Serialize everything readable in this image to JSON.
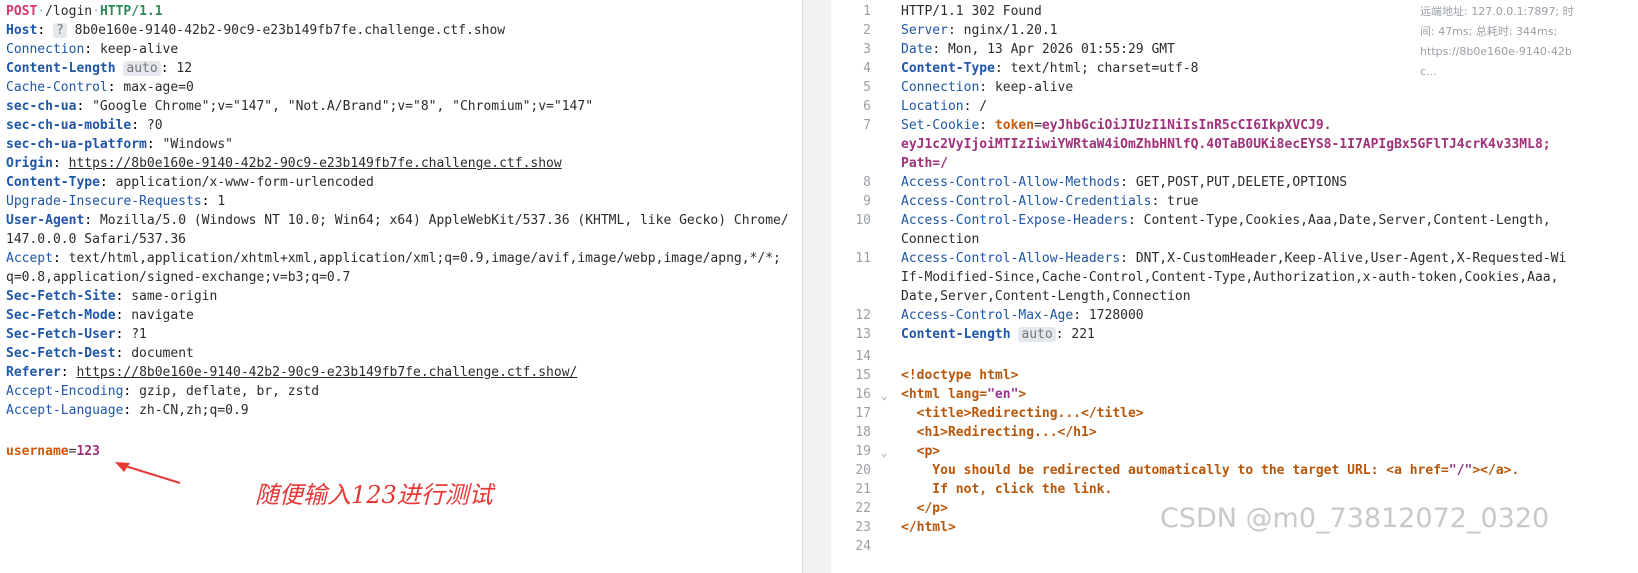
{
  "request": {
    "method": "POST",
    "path": "/login",
    "version": "HTTP/1.1",
    "headers": [
      {
        "k": "Host",
        "v": "8b0e160e-9140-42b2-90c9-e23b149fb7fe.challenge.ctf.show",
        "bold": true
      },
      {
        "k": "Connection",
        "v": "keep-alive",
        "bold": false
      },
      {
        "k": "Content-Length",
        "v": "12",
        "bold": true
      },
      {
        "k": "Cache-Control",
        "v": "max-age=0",
        "bold": false
      },
      {
        "k": "sec-ch-ua",
        "v": "\"Google Chrome\";v=\"147\", \"Not.A/Brand\";v=\"8\", \"Chromium\";v=\"147\"",
        "bold": true
      },
      {
        "k": "sec-ch-ua-mobile",
        "v": "?0",
        "bold": true
      },
      {
        "k": "sec-ch-ua-platform",
        "v": "\"Windows\"",
        "bold": true
      },
      {
        "k": "Origin",
        "v": "https://8b0e160e-9140-42b2-90c9-e23b149fb7fe.challenge.ctf.show",
        "bold": true
      },
      {
        "k": "Content-Type",
        "v": "application/x-www-form-urlencoded",
        "bold": true
      },
      {
        "k": "Upgrade-Insecure-Requests",
        "v": "1",
        "bold": false
      },
      {
        "k": "User-Agent",
        "v": "Mozilla/5.0 (Windows NT 10.0; Win64; x64) AppleWebKit/537.36 (KHTML, like Gecko) Chrome/",
        "bold": true
      },
      {
        "k": "",
        "v": "147.0.0.0 Safari/537.36",
        "bold": false
      },
      {
        "k": "Accept",
        "v": "text/html,application/xhtml+xml,application/xml;q=0.9,image/avif,image/webp,image/apng,*/*;",
        "bold": false
      },
      {
        "k": "",
        "v": "q=0.8,application/signed-exchange;v=b3;q=0.7",
        "bold": false
      },
      {
        "k": "Sec-Fetch-Site",
        "v": "same-origin",
        "bold": true
      },
      {
        "k": "Sec-Fetch-Mode",
        "v": "navigate",
        "bold": true
      },
      {
        "k": "Sec-Fetch-User",
        "v": "?1",
        "bold": true
      },
      {
        "k": "Sec-Fetch-Dest",
        "v": "document",
        "bold": true
      },
      {
        "k": "Referer",
        "v": "https://8b0e160e-9140-42b2-90c9-e23b149fb7fe.challenge.ctf.show/",
        "bold": true
      },
      {
        "k": "Accept-Encoding",
        "v": "gzip, deflate, br, zstd",
        "bold": false
      },
      {
        "k": "Accept-Language",
        "v": "zh-CN,zh;q=0.9",
        "bold": false
      }
    ],
    "host_badge": "?",
    "auto_badge": "auto",
    "body_key": "username",
    "body_value": "123"
  },
  "response": {
    "line_numbers": [
      "1",
      "2",
      "3",
      "4",
      "5",
      "6",
      "7",
      "",
      "",
      "8",
      "9",
      "10",
      "",
      "11",
      "",
      "",
      "12",
      "13",
      "14",
      "15",
      "16",
      "17",
      "18",
      "19",
      "20",
      "21",
      "22",
      "23",
      "24"
    ],
    "status": "HTTP/1.1 302 Found",
    "server": "nginx/1.20.1",
    "date": "Mon, 13 Apr 2026 01:55:29 GMT",
    "content_type": "text/html; charset=utf-8",
    "connection": "keep-alive",
    "location": "/",
    "set_cookie_key": "Set-Cookie",
    "cookie_name": "token",
    "cookie_value_1": "eyJhbGciOiJIUzI1NiIsInR5cCI6IkpXVCJ9.",
    "cookie_value_2": "eyJ1c2VyIjoiMTIzIiwiYWRtaW4iOmZhbHNlfQ.40TaB0UKi8ecEYS8-1I7APIgBx5GFlTJ4crK4v33ML8;",
    "cookie_path": "Path=/",
    "acam": "GET,POST,PUT,DELETE,OPTIONS",
    "acac": "true",
    "aceh_1": "Content-Type,Cookies,Aaa,Date,Server,Content-Length,",
    "aceh_2": "Connection",
    "acah_1": "DNT,X-CustomHeader,Keep-Alive,User-Agent,X-Requested-Wi",
    "acah_2": "If-Modified-Since,Cache-Control,Content-Type,Authorization,x-auth-token,Cookies,Aaa,",
    "acah_3": "Date,Server,Content-Length,Connection",
    "acma": "1728000",
    "content_length": "221",
    "auto_badge": "auto",
    "html_1": "<!doctype html>",
    "html_2_tag": "<html lang=",
    "html_2_attr": "\"en\"",
    "html_2_end": ">",
    "html_3": "  <title>Redirecting...</title>",
    "html_4": "  <h1>Redirecting...</h1>",
    "html_5": "  <p>",
    "html_6a": "    You should be redirected automatically to the target URL: <a href=",
    "html_6b": "\"/\"",
    "html_6c": "></a>.",
    "html_7": "    If not, click the link.",
    "html_8": "  </p>",
    "html_9": "</html>"
  },
  "info_panel": {
    "line1": "远端地址: 127.0.0.1:7897; 时",
    "line2": "间: 47ms; 总耗时: 344ms;",
    "line3": "https://8b0e160e-9140-42b",
    "line4": "c..."
  },
  "annotation_text": "随便输入123进行测试",
  "watermark": "CSDN @m0_73812072_0320"
}
